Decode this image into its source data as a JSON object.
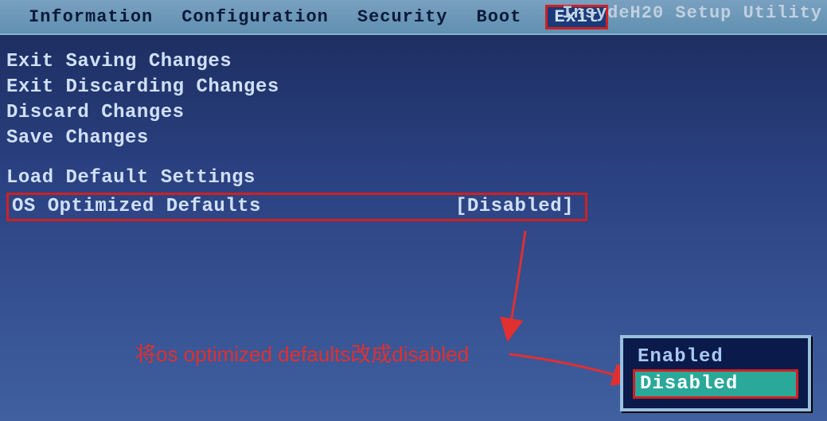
{
  "header": {
    "utility_title": "InsydeH20 Setup Utility",
    "menu": {
      "items": [
        "Information",
        "Configuration",
        "Security",
        "Boot",
        "Exit"
      ],
      "active": "Exit"
    }
  },
  "exit_page": {
    "items": {
      "exit_saving": "Exit Saving Changes",
      "exit_discarding": "Exit Discarding Changes",
      "discard": "Discard Changes",
      "save": "Save Changes",
      "load_defaults": "Load Default Settings",
      "os_optimized_label": "OS Optimized Defaults",
      "os_optimized_value": "[Disabled]"
    }
  },
  "popup": {
    "enabled": "Enabled",
    "disabled": "Disabled"
  },
  "annotation": {
    "text": "将os optimized defaults改成disabled"
  }
}
